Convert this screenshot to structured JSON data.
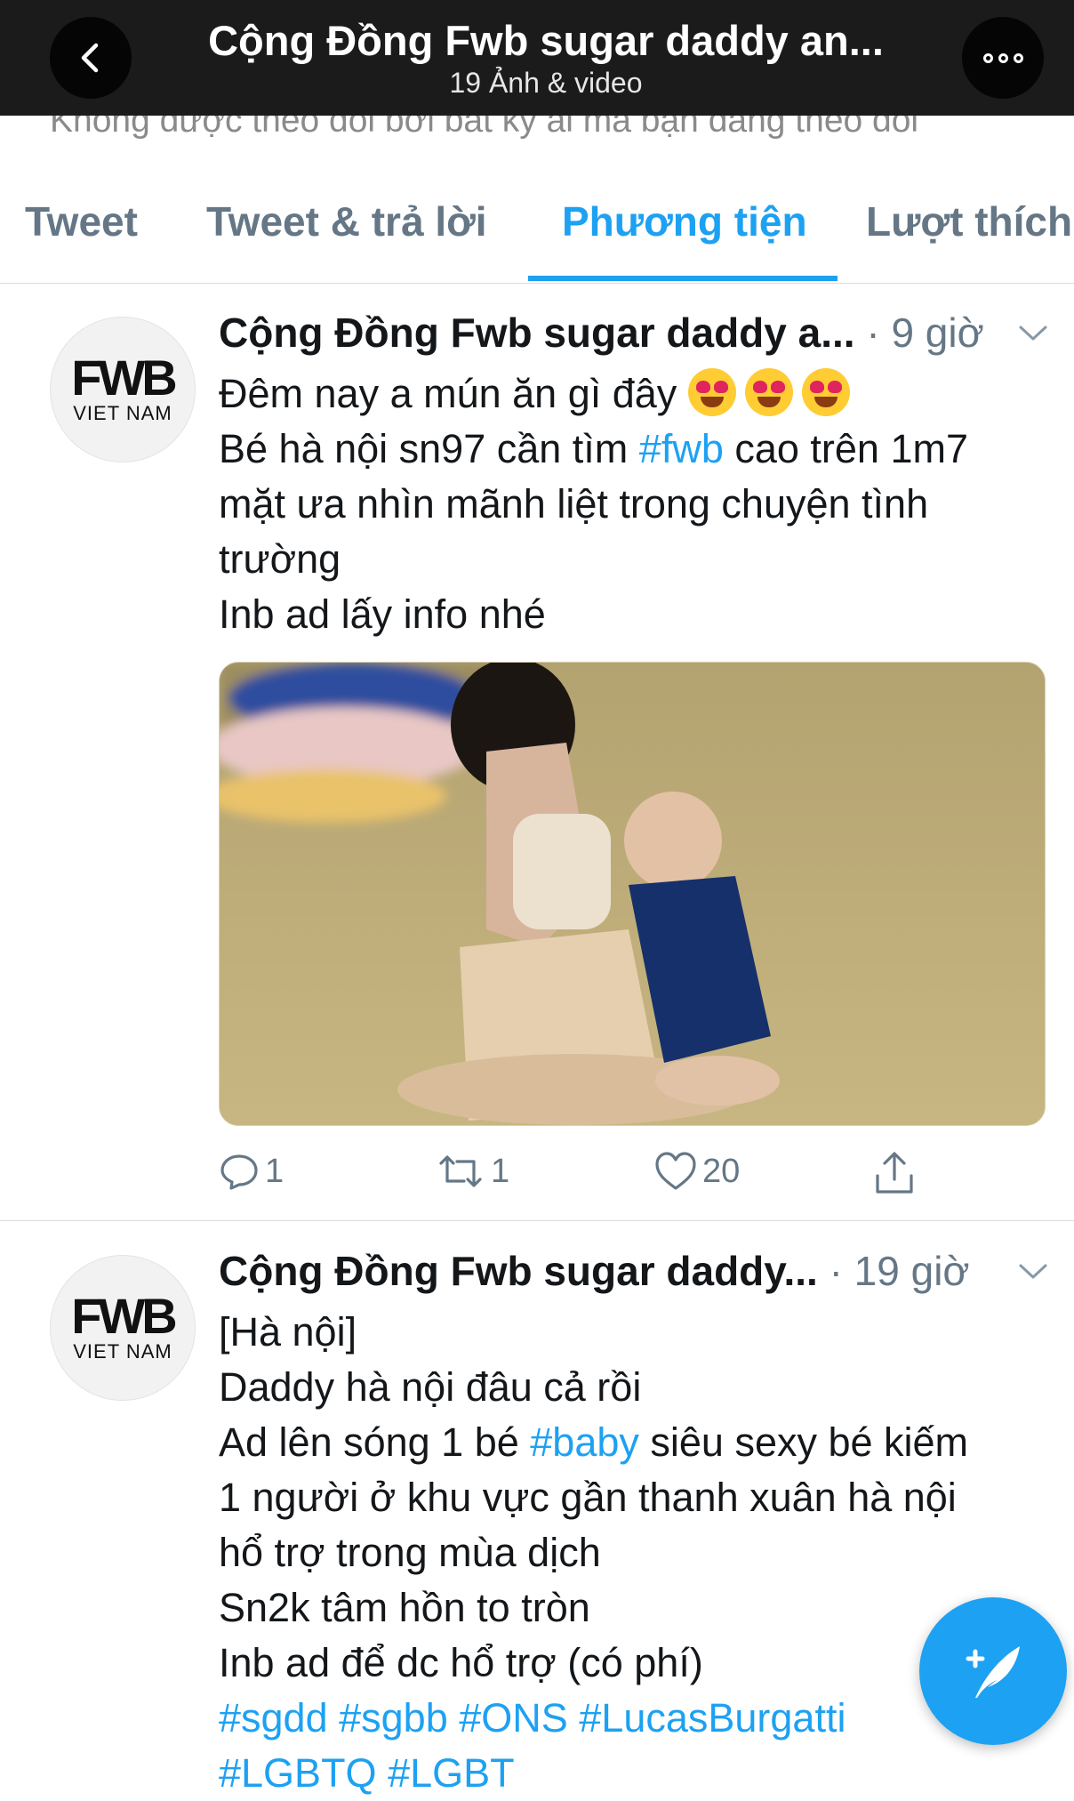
{
  "nav": {
    "title": "Cộng Đồng Fwb sugar daddy an...",
    "subtitle": "19 Ảnh & video"
  },
  "profile": {
    "followed_by_line": "Không được theo dõi bởi bất kỳ ai mà bạn đang theo dõi"
  },
  "tabs": [
    {
      "label": "Tweet"
    },
    {
      "label": "Tweet & trả lời"
    },
    {
      "label": "Phương tiện",
      "active": true
    },
    {
      "label": "Lượt thích"
    }
  ],
  "avatar": {
    "logo": "FWB",
    "sub": "VIET NAM"
  },
  "tweets": [
    {
      "name": "Cộng Đồng Fwb sugar daddy a...",
      "time": "· 9 giờ",
      "line1": "Đêm nay a mún ăn gì đây",
      "line2_pre": "Bé hà nội sn97 cần tìm ",
      "line2_tag": "#fwb",
      "line2_post": " cao trên 1m7",
      "line3": "mặt ưa  nhìn mãnh liệt trong chuyện tình",
      "line4": "trường",
      "line5": "Inb ad lấy info nhé",
      "replies": "1",
      "retweets": "1",
      "likes": "20"
    },
    {
      "name": "Cộng Đồng Fwb sugar daddy...",
      "time": " · 19 giờ",
      "line1": "[Hà nội]",
      "line2": "Daddy hà nội đâu cả rồi",
      "line3_pre": "Ad lên sóng 1 bé ",
      "line3_tag": "#baby",
      "line3_post": " siêu sexy bé kiếm",
      "line4": "1 người ở khu vực gần thanh xuân hà nội",
      "line5": "hổ trợ trong mùa dịch",
      "line6": "Sn2k tâm hồn to tròn",
      "line7": "Inb ad để dc hổ trợ (có phí)",
      "tags1": "#sgdd #sgbb #ONS #LucasBurgatti",
      "tags2": "#LGBTQ #LGBT"
    }
  ],
  "colors": {
    "accent": "#1da1f2",
    "text": "#14171a",
    "muted": "#657786",
    "navbar": "#1b1b1b"
  },
  "icons": [
    "back-chevron-icon",
    "more-icon",
    "chevron-down-icon",
    "reply-icon",
    "retweet-icon",
    "like-icon",
    "share-icon",
    "compose-tweet-icon"
  ]
}
